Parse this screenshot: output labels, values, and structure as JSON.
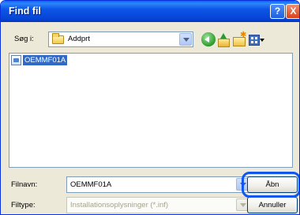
{
  "window": {
    "title": "Find fil",
    "help_label": "?",
    "close_label": "X"
  },
  "lookin": {
    "label": "Søg i:",
    "value": "Addprt"
  },
  "toolbar": {
    "icons": [
      "back-icon",
      "up-folder-icon",
      "new-folder-icon",
      "views-menu-icon"
    ]
  },
  "filelist": {
    "items": [
      {
        "name": "OEMMF01A",
        "selected": true
      }
    ]
  },
  "filename": {
    "label": "Filnavn:",
    "value": "OEMMF01A"
  },
  "filetype": {
    "label": "Filtype:",
    "value": "Installationsoplysninger (*.inf)",
    "disabled": true
  },
  "buttons": {
    "open_label": "Åbn",
    "cancel_label": "Annuller"
  },
  "colors": {
    "titlebar": "#0a5ae8",
    "selection": "#316ac5",
    "focus_ring": "#1256f0",
    "dialog_bg": "#ece9d8"
  }
}
